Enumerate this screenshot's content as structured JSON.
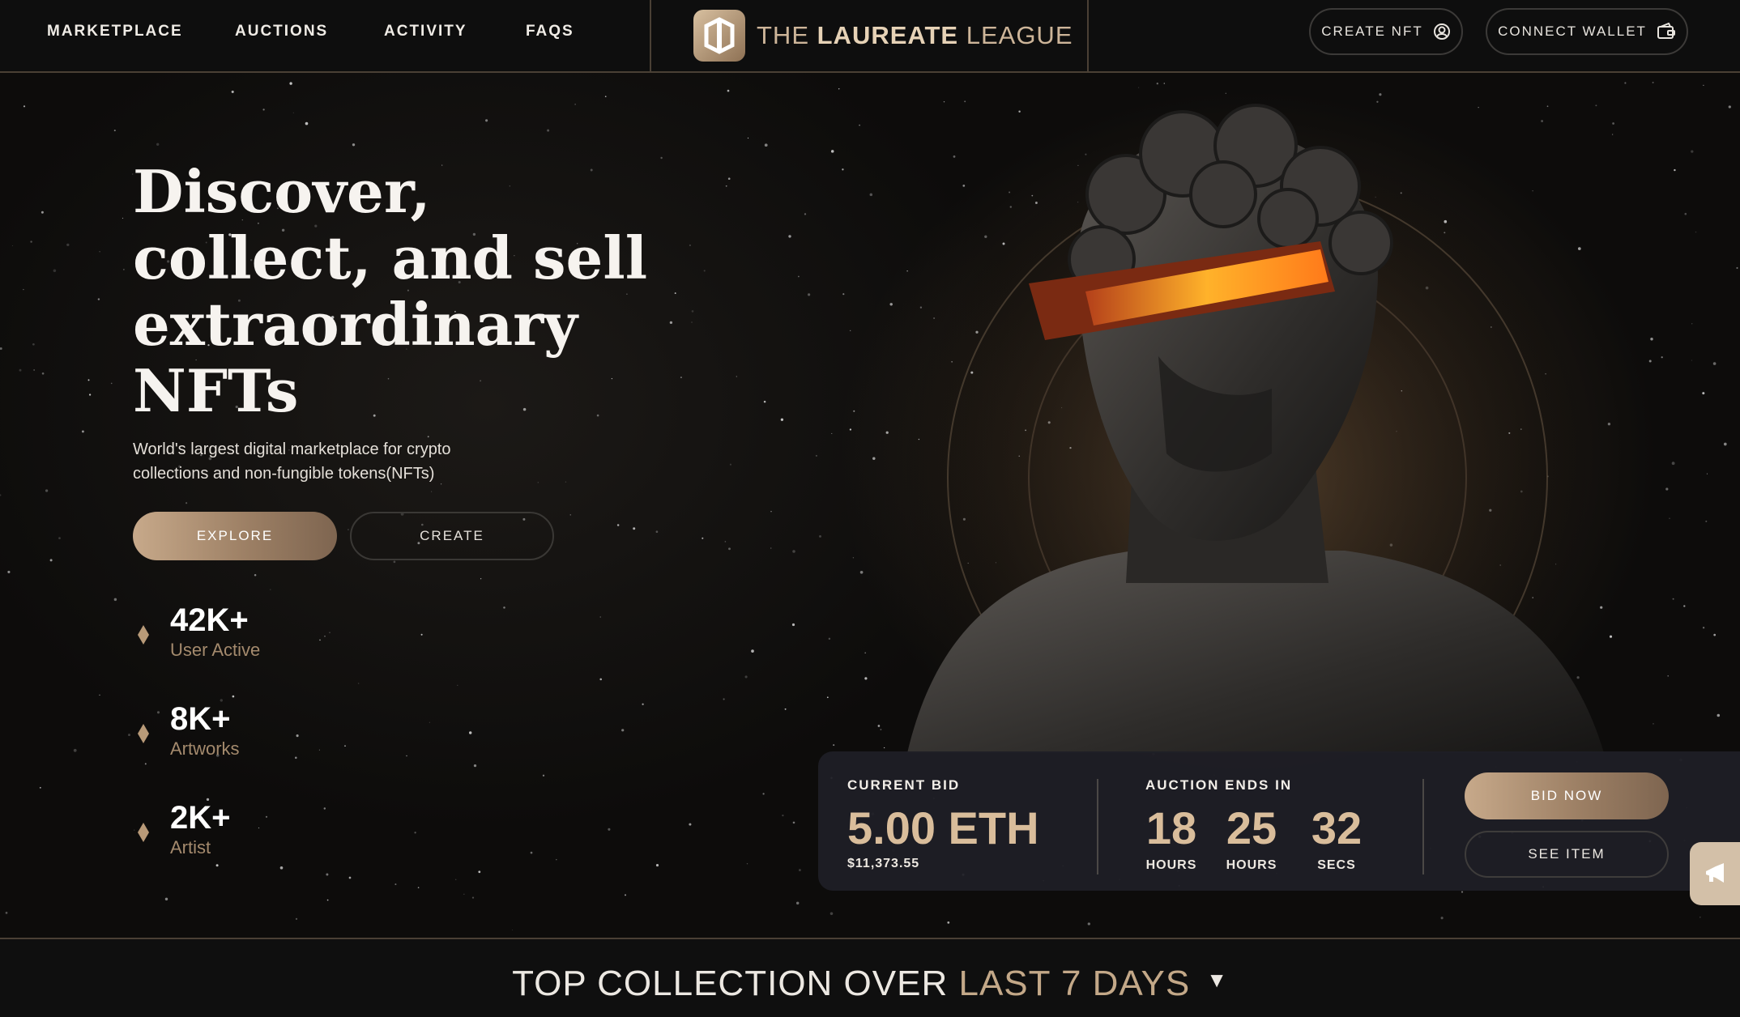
{
  "nav": {
    "links": [
      "MARKETPLACE",
      "AUCTIONS",
      "ACTIVITY",
      "FAQS"
    ],
    "brand": {
      "prefix": "THE ",
      "bold": "LAUREATE",
      "suffix": " LEAGUE"
    },
    "create_nft_label": "CREATE NFT",
    "connect_wallet_label": "CONNECT WALLET"
  },
  "hero": {
    "headline": "Discover, collect, and sell extraordinary NFTs",
    "subtitle": "World's largest digital marketplace for crypto collections and non-fungible tokens(NFTs)",
    "explore_label": "EXPLORE",
    "create_label": "CREATE",
    "stats": [
      {
        "value": "42K+",
        "label": "User Active"
      },
      {
        "value": "8K+",
        "label": "Artworks"
      },
      {
        "value": "2K+",
        "label": "Artist"
      }
    ]
  },
  "auction": {
    "current_bid_label": "CURRENT BID",
    "price": "5.00 ETH",
    "usd": "$11,373.55",
    "ends_label": "AUCTION ENDS IN",
    "timer": [
      {
        "value": "18",
        "unit": "HOURS"
      },
      {
        "value": "25",
        "unit": "HOURS"
      },
      {
        "value": "32",
        "unit": "SECS"
      }
    ],
    "bid_label": "BID NOW",
    "see_label": "SEE ITEM"
  },
  "bottom": {
    "title_main": "TOP COLLECTION OVER ",
    "title_accent": "LAST 7 DAYS",
    "caret": "▼"
  },
  "colors": {
    "accent_gold": "#d9bd9b",
    "background": "#0b0a09",
    "card": "#1f1f26"
  },
  "icons": {
    "create_nft": "user-circle-icon",
    "connect_wallet": "wallet-icon",
    "brand": "laureate-logo-icon",
    "stat_marker": "diamond-icon",
    "announce": "megaphone-icon"
  }
}
